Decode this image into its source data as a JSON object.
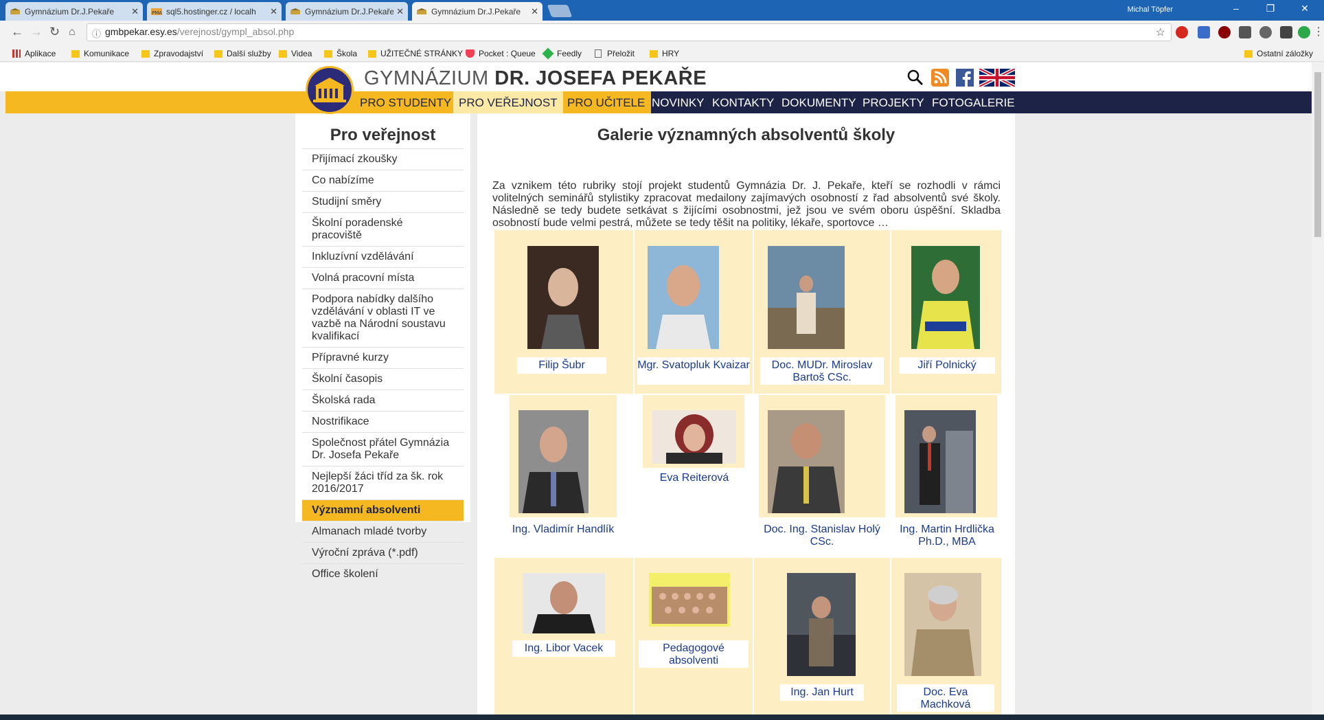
{
  "browser": {
    "tabs": [
      {
        "title": "Gymnázium Dr.J.Pekaře",
        "active": false
      },
      {
        "title": "sql5.hostinger.cz / localh",
        "active": false
      },
      {
        "title": "Gymnázium Dr.J.Pekaře",
        "active": false
      },
      {
        "title": "Gymnázium Dr.J.Pekaře",
        "active": true
      }
    ],
    "user": "Michal Töpfer",
    "url_domain": "gmbpekar.esy.es",
    "url_path": "/verejnost/gympl_absol.php",
    "bookmarks": [
      "Aplikace",
      "Komunikace",
      "Zpravodajství",
      "Další služby",
      "Videa",
      "Škola",
      "UŽITEČNÉ STRÁNKY",
      "Pocket : Queue",
      "Feedly",
      "Přeložit",
      "HRY"
    ],
    "other_bookmarks": "Ostatní záložky"
  },
  "site": {
    "title_light": "GYMNÁZIUM",
    "title_bold": "DR. JOSEFA PEKAŘE",
    "nav": [
      "PRO STUDENTY",
      "PRO VEŘEJNOST",
      "PRO UČITELE",
      "NOVINKY",
      "KONTAKTY",
      "DOKUMENTY",
      "PROJEKTY",
      "FOTOGALERIE"
    ],
    "nav_selected": "PRO VEŘEJNOST"
  },
  "sidebar": {
    "heading": "Pro veřejnost",
    "items": [
      "Přijímací zkoušky",
      "Co nabízíme",
      "Studijní směry",
      "Školní poradenské pracoviště",
      "Inkluzívní vzdělávání",
      "Volná pracovní místa",
      "Podpora nabídky dalšího vzdělávání v oblasti IT ve vazbě na Národní soustavu kvalifikací",
      "Přípravné kurzy",
      "Školní časopis",
      "Školská rada",
      "Nostrifikace",
      "Společnost přátel Gymnázia Dr. Josefa Pekaře",
      "Nejlepší žáci tříd za šk. rok 2016/2017",
      "Významní absolventi",
      "Almanach mladé tvorby",
      "Výroční zpráva (*.pdf)",
      "Office školení"
    ],
    "active_item": "Významní absolventi"
  },
  "main": {
    "heading": "Galerie významných absolventů školy",
    "intro": "Za vznikem této rubriky stojí projekt studentů Gymnázia Dr. J. Pekaře, kteří se rozhodli v rámci volitelných seminářů stylistiky zpracovat medailony zajímavých osobností z řad absolventů své školy. Následně se tedy budete setkávat s žijícími osobnostmi, jež jsou ve svém oboru úspěšní. Skladba osobností bude velmi pestrá, můžete se tedy těšit na politiky, lékaře, sportovce …",
    "graduates": [
      "Filip Šubr",
      "Mgr. Svatopluk Kvaizar",
      "Doc. MUDr. Miroslav Bartoš CSc.",
      "Jiří Polnický",
      "Ing. Vladimír Handlík",
      "Eva Reiterová",
      "Doc. Ing. Stanislav Holý CSc.",
      "Ing. Martin Hrdlička Ph.D., MBA",
      "Ing. Libor Vacek",
      "Pedagogové absolventi",
      "Ing. Jan Hurt",
      "Doc. Eva Machková"
    ]
  },
  "colors": {
    "accent_yellow": "#f5b820",
    "nav_dark": "#1d2346",
    "cell_bg": "#fdeec4",
    "link_blue": "#1a3a8f"
  }
}
